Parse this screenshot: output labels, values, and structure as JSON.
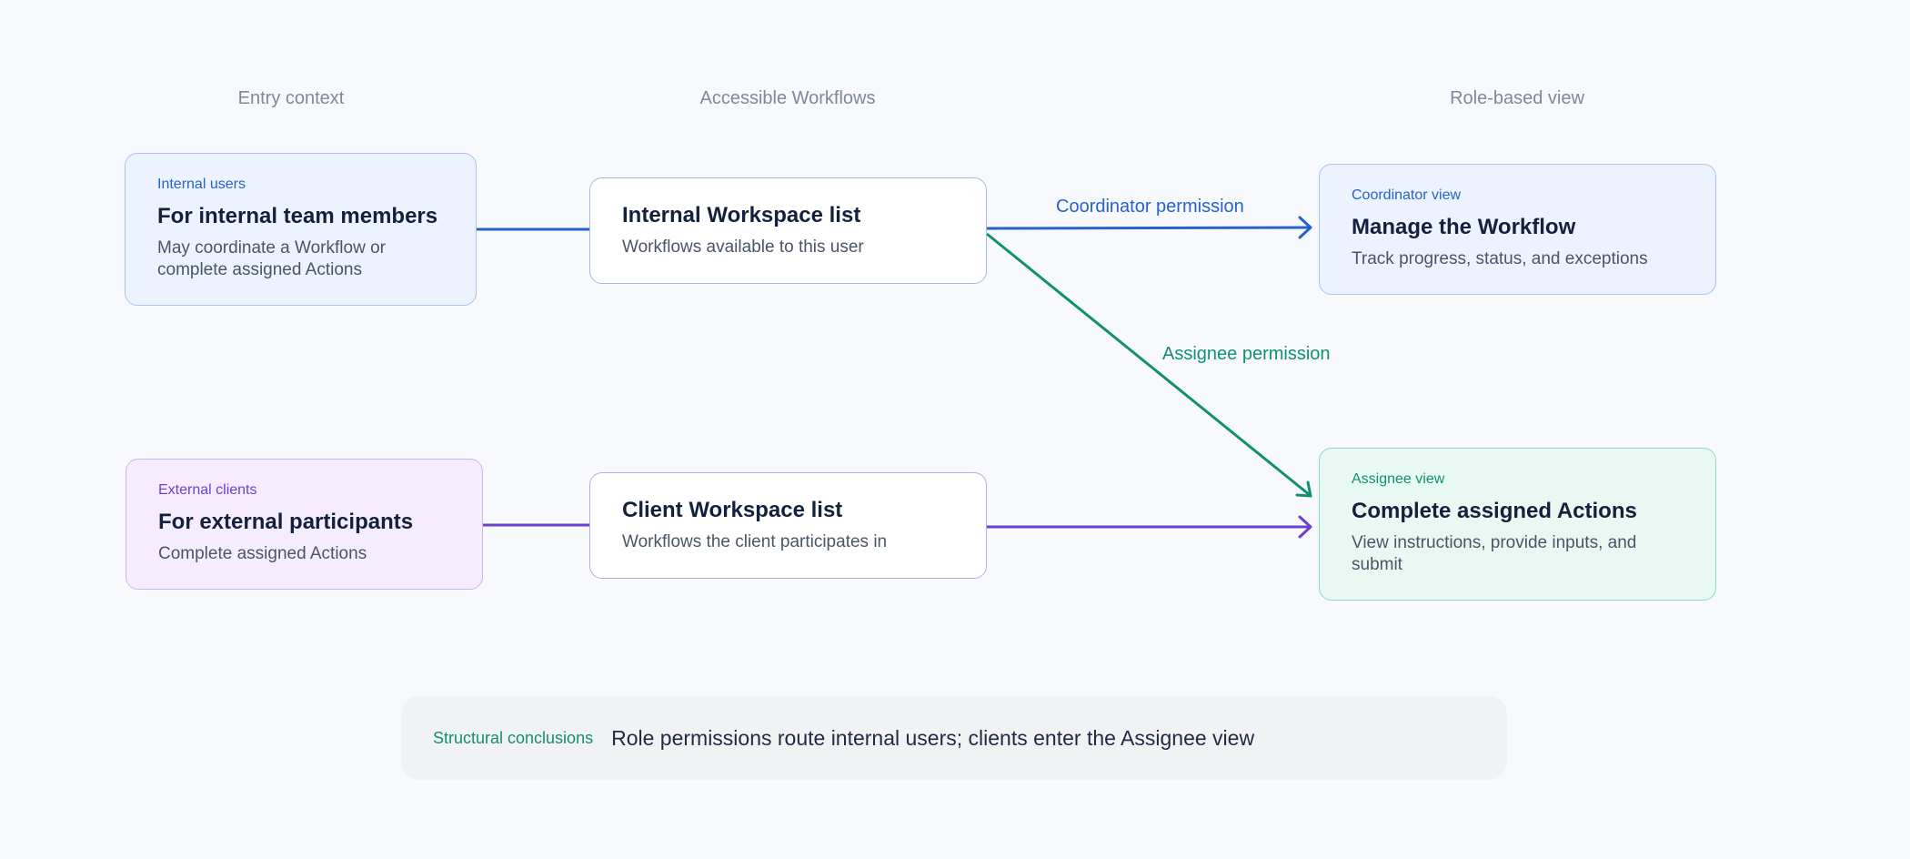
{
  "columns": {
    "entry": "Entry context",
    "workflows": "Accessible Workflows",
    "role": "Role-based view"
  },
  "nodes": {
    "internal_users": {
      "tag": "Internal users",
      "title": "For internal team members",
      "sub": "May coordinate a Workflow or complete assigned Actions"
    },
    "external_clients": {
      "tag": "External clients",
      "title": "For external participants",
      "sub": "Complete assigned Actions"
    },
    "internal_workspace": {
      "title": "Internal Workspace list",
      "sub": "Workflows available to this user"
    },
    "client_workspace": {
      "title": "Client Workspace list",
      "sub": "Workflows the client participates in"
    },
    "coordinator_view": {
      "tag": "Coordinator view",
      "title": "Manage the Workflow",
      "sub": "Track progress, status, and exceptions"
    },
    "assignee_view": {
      "tag": "Assignee view",
      "title": "Complete assigned Actions",
      "sub": "View instructions, provide inputs, and submit"
    }
  },
  "edges": {
    "coordinator_label": "Coordinator permission",
    "assignee_label": "Assignee permission"
  },
  "conclusion": {
    "label": "Structural conclusions",
    "text": "Role permissions route internal users; clients enter the Assignee view"
  },
  "colors": {
    "blue": "#2563c9",
    "green": "#119070",
    "purple": "#6d3fd1"
  }
}
